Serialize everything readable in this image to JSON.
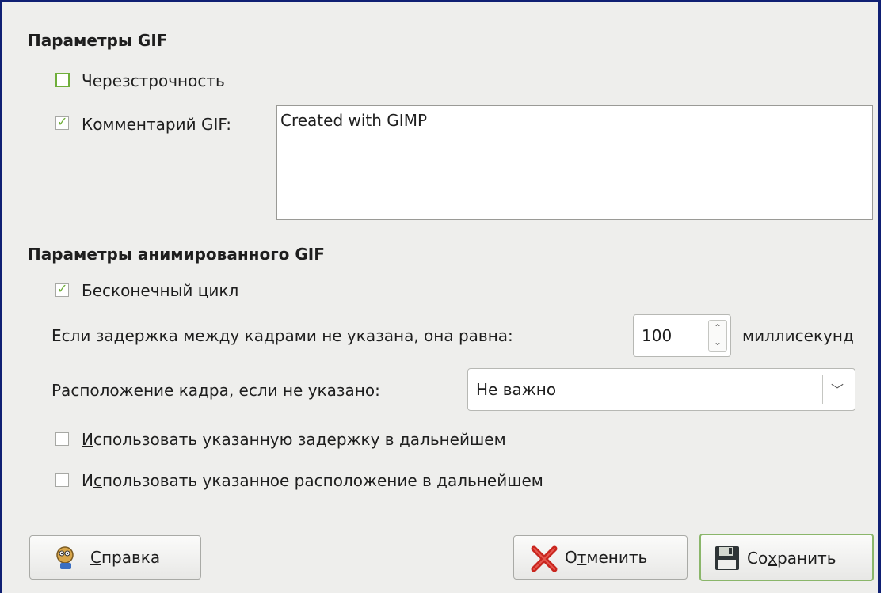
{
  "gif_options": {
    "title": "Параметры GIF",
    "interlace_label": "Черезстрочность",
    "interlace_checked": false,
    "comment_label": "Комментарий GIF:",
    "comment_checked": true,
    "comment_value": "Created with GIMP"
  },
  "anim_options": {
    "title": "Параметры анимированного GIF",
    "loop_label": "Бесконечный цикл",
    "loop_checked": true,
    "delay_label": "Если задержка между кадрами не указана, она равна:",
    "delay_value": "100",
    "delay_unit": "миллисекунд",
    "disposal_label": "Расположение кадра, если не указано:",
    "disposal_value": "Не важно",
    "use_delay_pre": "",
    "use_delay_mnemonic": "И",
    "use_delay_post": "спользовать указанную задержку в дальнейшем",
    "use_delay_checked": false,
    "use_disposal_pre": "И",
    "use_disposal_mnemonic": "с",
    "use_disposal_post": "пользовать указанное расположение в дальнейшем",
    "use_disposal_checked": false
  },
  "buttons": {
    "help_mnemonic": "С",
    "help_rest": "правка",
    "cancel_pre": "О",
    "cancel_mnemonic": "т",
    "cancel_post": "менить",
    "save_pre": "Со",
    "save_mnemonic": "х",
    "save_post": "ранить"
  },
  "icons": {
    "help": "help-wilber-icon",
    "cancel": "red-x-icon",
    "save": "floppy-disk-icon"
  },
  "colors": {
    "frame_border": "#0f1f73",
    "check_green": "#6fae3a",
    "default_button_border": "#8ab66a"
  }
}
